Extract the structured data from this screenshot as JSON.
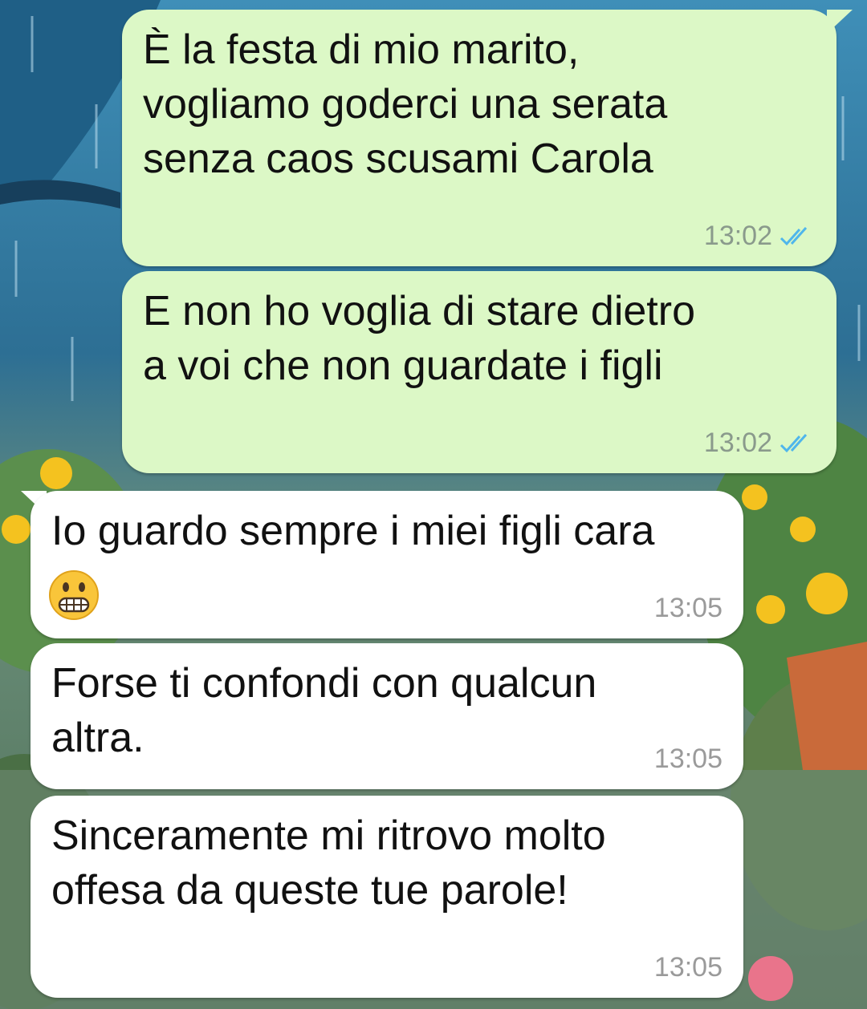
{
  "messages": [
    {
      "direction": "outgoing",
      "text": "È la festa di mio marito,\nvogliamo goderci una serata\nsenza caos scusami Carola",
      "time": "13:02",
      "status": "read"
    },
    {
      "direction": "outgoing",
      "text": "E non ho voglia di stare dietro\na voi che non guardate i figli",
      "time": "13:02",
      "status": "read"
    },
    {
      "direction": "incoming",
      "text": "Io guardo sempre i miei figli cara",
      "emoji": "grimacing-face",
      "time": "13:05"
    },
    {
      "direction": "incoming",
      "text": "Forse ti confondi con qualcun\naltra.",
      "time": "13:05"
    },
    {
      "direction": "incoming",
      "text": "Sinceramente mi ritrovo molto\noffesa da queste tue parole!",
      "time": "13:05"
    }
  ],
  "colors": {
    "outgoing_bubble": "#dcf8c6",
    "incoming_bubble": "#ffffff",
    "read_ticks": "#4fb6ec"
  }
}
